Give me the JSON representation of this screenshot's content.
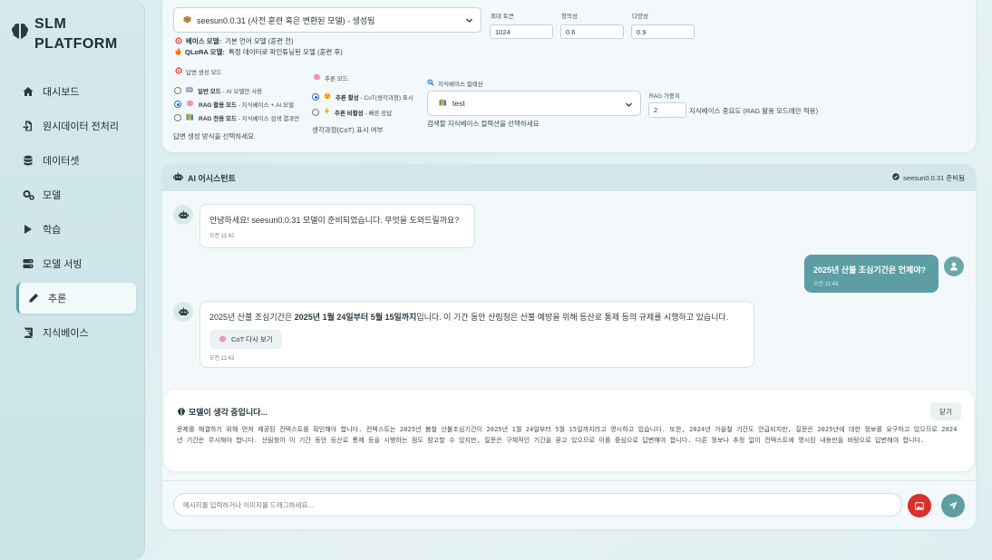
{
  "brand": {
    "line1": "SLM",
    "line2": "PLATFORM"
  },
  "sidebar": {
    "items": [
      {
        "label": "대시보드",
        "icon": "home-icon"
      },
      {
        "label": "원시데이터 전처리",
        "icon": "file-import-icon"
      },
      {
        "label": "데이터셋",
        "icon": "database-icon"
      },
      {
        "label": "모델",
        "icon": "gears-icon"
      },
      {
        "label": "학습",
        "icon": "play-icon"
      },
      {
        "label": "모델 서빙",
        "icon": "server-icon"
      },
      {
        "label": "추론",
        "icon": "pen-icon",
        "active": true
      },
      {
        "label": "지식베이스",
        "icon": "book-icon"
      }
    ]
  },
  "settings": {
    "model_select": "seesun0.0.31 (사전 훈련 혹은 변환된 모델) - 생성됨",
    "base_model_label": "베이스 모델:",
    "base_model_desc": "기본 언어 모델 (훈련 전)",
    "qlora_label": "QLoRA 모델:",
    "qlora_desc": "특정 데이터로 파인튜닝된 모델 (훈련 후)",
    "max_tokens_label": "최대 토큰",
    "max_tokens_value": "1024",
    "creativity_label": "창의성",
    "creativity_value": "0.6",
    "diversity_label": "다양성",
    "diversity_value": "0.9",
    "gen_mode_title": "답변 생성 모드",
    "gen_modes": [
      {
        "name": "일반 모드",
        "desc": " - AI 모델만 사용",
        "selected": false
      },
      {
        "name": "RAG 활용 모드",
        "desc": " - 지식베이스 + AI 모델",
        "selected": true
      },
      {
        "name": "RAG 전용 모드",
        "desc": " - 지식베이스 검색 결과만",
        "selected": false
      }
    ],
    "gen_mode_hint": "답변 생성 방식을 선택하세요",
    "reasoning_title": "추론 모드",
    "reasoning_modes": [
      {
        "name": "추론 활성",
        "desc": " - CoT(생각과정) 표시",
        "selected": true
      },
      {
        "name": "추론 비활성",
        "desc": " - 빠른 응답",
        "selected": false
      }
    ],
    "reasoning_hint": "생각과정(CoT) 표시 여부",
    "kb_title": "지식베이스 컬렉션",
    "kb_value": "test",
    "kb_hint": "검색할 지식베이스 컬렉션을 선택하세요",
    "rag_weight_label": "RAG 가중치",
    "rag_weight_value": "2",
    "rag_weight_hint": "지식베이스 중요도 (RAG 활용 모드에만 적용)"
  },
  "chat": {
    "title": "AI 어시스턴트",
    "status": "seesun0.0.31 준비됨",
    "messages": [
      {
        "role": "bot",
        "text": "안녕하세요! seesun0.0.31 모델이 준비되었습니다. 무엇을 도와드릴까요?",
        "time": "오전 11:42"
      },
      {
        "role": "user",
        "text": "2025년 산불 조심기간은 언제야?",
        "time": "오전 11:43"
      },
      {
        "role": "bot",
        "text_before": "2025년 산불 조심기간은 ",
        "text_bold": "2025년 1월 24일부터 5월 15일까지",
        "text_after": "입니다. 이 기간 동안 산림청은 산불 예방을 위해 등산로 통제 등의 규제를 시행하고 있습니다.",
        "cot_button": "CoT 다시 보기",
        "time": "오전 11:43"
      }
    ],
    "thinking_title": "모델이 생각 중입니다...",
    "close_label": "닫기",
    "thinking_text": "문제를 해결하기 위해 먼저 제공된 컨텍스트를 확인해야 합니다. 컨텍스트는 2025년 봄철 산불조심기간이 2025년 1월 24일부터 5월 15일까지라고 명시하고 있습니다. 또한, 2024년 가을철 기간도 언급되지만, 질문은 2025년에 대한 정보를 요구하고 있으므로 2024년 기간은 무시해야 합니다. 산림청이 이 기간 동안 등산로 통제 등을 시행하는 점도 참고할 수 있지만, 질문은 구체적인 기간을 묻고 있으므로 이를 중심으로 답변해야 합니다. 다른 정보나 추정 없이 컨텍스트에 명시된 내용만을 바탕으로 답변해야 합니다.",
    "input_placeholder": "메시지를 입력하거나 이미지를 드래그하세요..."
  },
  "colors": {
    "accent": "#5c9ea3",
    "danger": "#d9302c",
    "send": "#5f9ea3",
    "radio": "#1f6fd1"
  }
}
